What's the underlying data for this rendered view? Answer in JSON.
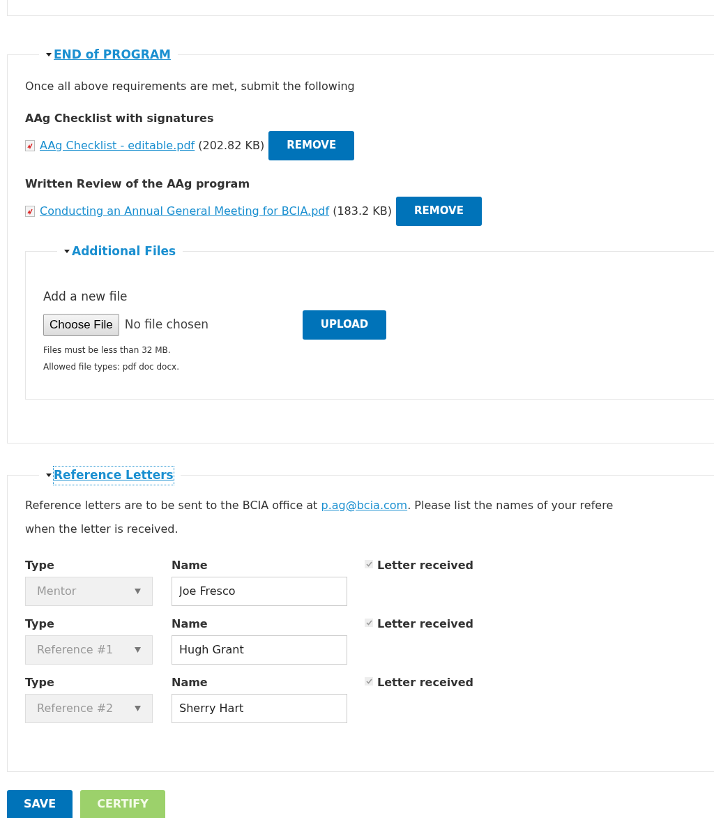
{
  "end_of_program": {
    "legend": "END of PROGRAM",
    "intro": "Once all above requirements are met, submit the following",
    "files": [
      {
        "label": "AAg Checklist with signatures",
        "file_name": "AAg Checklist - editable.pdf",
        "size": "(202.82 KB)",
        "button": "REMOVE"
      },
      {
        "label": "Written Review of the AAg program",
        "file_name": "Conducting an Annual General Meeting for BCIA.pdf",
        "size": "(183.2 KB)",
        "button": "REMOVE"
      }
    ],
    "additional_files": {
      "legend": "Additional Files",
      "label": "Add a new file",
      "choose_button": "Choose File",
      "file_status": "No file chosen",
      "upload_button": "UPLOAD",
      "hints": [
        "Files must be less than 32 MB.",
        "Allowed file types: pdf doc docx."
      ]
    }
  },
  "reference_letters": {
    "legend": "Reference Letters",
    "text_before": "Reference letters are to be sent to the BCIA office at ",
    "email": "p.ag@bcia.com",
    "text_after": ". Please list the names of your refere",
    "text_line2": "when the letter is received.",
    "rows": [
      {
        "type_label": "Type",
        "type_value": "Mentor",
        "name_label": "Name",
        "name_value": "Joe Fresco",
        "received_label": "Letter received",
        "checked": true,
        "disabled": true
      },
      {
        "type_label": "Type",
        "type_value": "Reference #1",
        "name_label": "Name",
        "name_value": "Hugh Grant",
        "received_label": "Letter received",
        "checked": true,
        "disabled": true
      },
      {
        "type_label": "Type",
        "type_value": "Reference #2",
        "name_label": "Name",
        "name_value": "Sherry Hart",
        "received_label": "Letter received",
        "checked": true,
        "disabled": true
      }
    ]
  },
  "actions": [
    {
      "label": "SAVE",
      "kind": "primary"
    },
    {
      "label": "CERTIFY",
      "kind": "success"
    }
  ]
}
